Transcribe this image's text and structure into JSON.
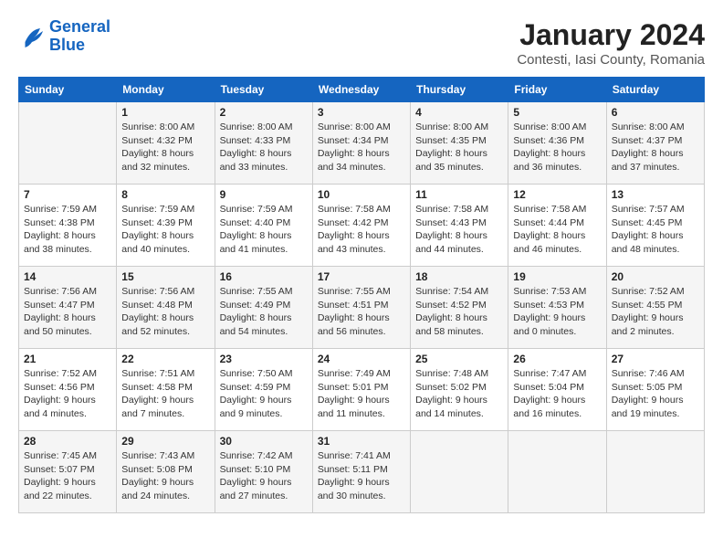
{
  "logo": {
    "line1": "General",
    "line2": "Blue"
  },
  "title": "January 2024",
  "subtitle": "Contesti, Iasi County, Romania",
  "weekdays": [
    "Sunday",
    "Monday",
    "Tuesday",
    "Wednesday",
    "Thursday",
    "Friday",
    "Saturday"
  ],
  "weeks": [
    [
      {
        "day": null
      },
      {
        "day": "1",
        "sunrise": "8:00 AM",
        "sunset": "4:32 PM",
        "daylight": "8 hours and 32 minutes."
      },
      {
        "day": "2",
        "sunrise": "8:00 AM",
        "sunset": "4:33 PM",
        "daylight": "8 hours and 33 minutes."
      },
      {
        "day": "3",
        "sunrise": "8:00 AM",
        "sunset": "4:34 PM",
        "daylight": "8 hours and 34 minutes."
      },
      {
        "day": "4",
        "sunrise": "8:00 AM",
        "sunset": "4:35 PM",
        "daylight": "8 hours and 35 minutes."
      },
      {
        "day": "5",
        "sunrise": "8:00 AM",
        "sunset": "4:36 PM",
        "daylight": "8 hours and 36 minutes."
      },
      {
        "day": "6",
        "sunrise": "8:00 AM",
        "sunset": "4:37 PM",
        "daylight": "8 hours and 37 minutes."
      }
    ],
    [
      {
        "day": "7",
        "sunrise": "7:59 AM",
        "sunset": "4:38 PM",
        "daylight": "8 hours and 38 minutes."
      },
      {
        "day": "8",
        "sunrise": "7:59 AM",
        "sunset": "4:39 PM",
        "daylight": "8 hours and 40 minutes."
      },
      {
        "day": "9",
        "sunrise": "7:59 AM",
        "sunset": "4:40 PM",
        "daylight": "8 hours and 41 minutes."
      },
      {
        "day": "10",
        "sunrise": "7:58 AM",
        "sunset": "4:42 PM",
        "daylight": "8 hours and 43 minutes."
      },
      {
        "day": "11",
        "sunrise": "7:58 AM",
        "sunset": "4:43 PM",
        "daylight": "8 hours and 44 minutes."
      },
      {
        "day": "12",
        "sunrise": "7:58 AM",
        "sunset": "4:44 PM",
        "daylight": "8 hours and 46 minutes."
      },
      {
        "day": "13",
        "sunrise": "7:57 AM",
        "sunset": "4:45 PM",
        "daylight": "8 hours and 48 minutes."
      }
    ],
    [
      {
        "day": "14",
        "sunrise": "7:56 AM",
        "sunset": "4:47 PM",
        "daylight": "8 hours and 50 minutes."
      },
      {
        "day": "15",
        "sunrise": "7:56 AM",
        "sunset": "4:48 PM",
        "daylight": "8 hours and 52 minutes."
      },
      {
        "day": "16",
        "sunrise": "7:55 AM",
        "sunset": "4:49 PM",
        "daylight": "8 hours and 54 minutes."
      },
      {
        "day": "17",
        "sunrise": "7:55 AM",
        "sunset": "4:51 PM",
        "daylight": "8 hours and 56 minutes."
      },
      {
        "day": "18",
        "sunrise": "7:54 AM",
        "sunset": "4:52 PM",
        "daylight": "8 hours and 58 minutes."
      },
      {
        "day": "19",
        "sunrise": "7:53 AM",
        "sunset": "4:53 PM",
        "daylight": "9 hours and 0 minutes."
      },
      {
        "day": "20",
        "sunrise": "7:52 AM",
        "sunset": "4:55 PM",
        "daylight": "9 hours and 2 minutes."
      }
    ],
    [
      {
        "day": "21",
        "sunrise": "7:52 AM",
        "sunset": "4:56 PM",
        "daylight": "9 hours and 4 minutes."
      },
      {
        "day": "22",
        "sunrise": "7:51 AM",
        "sunset": "4:58 PM",
        "daylight": "9 hours and 7 minutes."
      },
      {
        "day": "23",
        "sunrise": "7:50 AM",
        "sunset": "4:59 PM",
        "daylight": "9 hours and 9 minutes."
      },
      {
        "day": "24",
        "sunrise": "7:49 AM",
        "sunset": "5:01 PM",
        "daylight": "9 hours and 11 minutes."
      },
      {
        "day": "25",
        "sunrise": "7:48 AM",
        "sunset": "5:02 PM",
        "daylight": "9 hours and 14 minutes."
      },
      {
        "day": "26",
        "sunrise": "7:47 AM",
        "sunset": "5:04 PM",
        "daylight": "9 hours and 16 minutes."
      },
      {
        "day": "27",
        "sunrise": "7:46 AM",
        "sunset": "5:05 PM",
        "daylight": "9 hours and 19 minutes."
      }
    ],
    [
      {
        "day": "28",
        "sunrise": "7:45 AM",
        "sunset": "5:07 PM",
        "daylight": "9 hours and 22 minutes."
      },
      {
        "day": "29",
        "sunrise": "7:43 AM",
        "sunset": "5:08 PM",
        "daylight": "9 hours and 24 minutes."
      },
      {
        "day": "30",
        "sunrise": "7:42 AM",
        "sunset": "5:10 PM",
        "daylight": "9 hours and 27 minutes."
      },
      {
        "day": "31",
        "sunrise": "7:41 AM",
        "sunset": "5:11 PM",
        "daylight": "9 hours and 30 minutes."
      },
      {
        "day": null
      },
      {
        "day": null
      },
      {
        "day": null
      }
    ]
  ]
}
